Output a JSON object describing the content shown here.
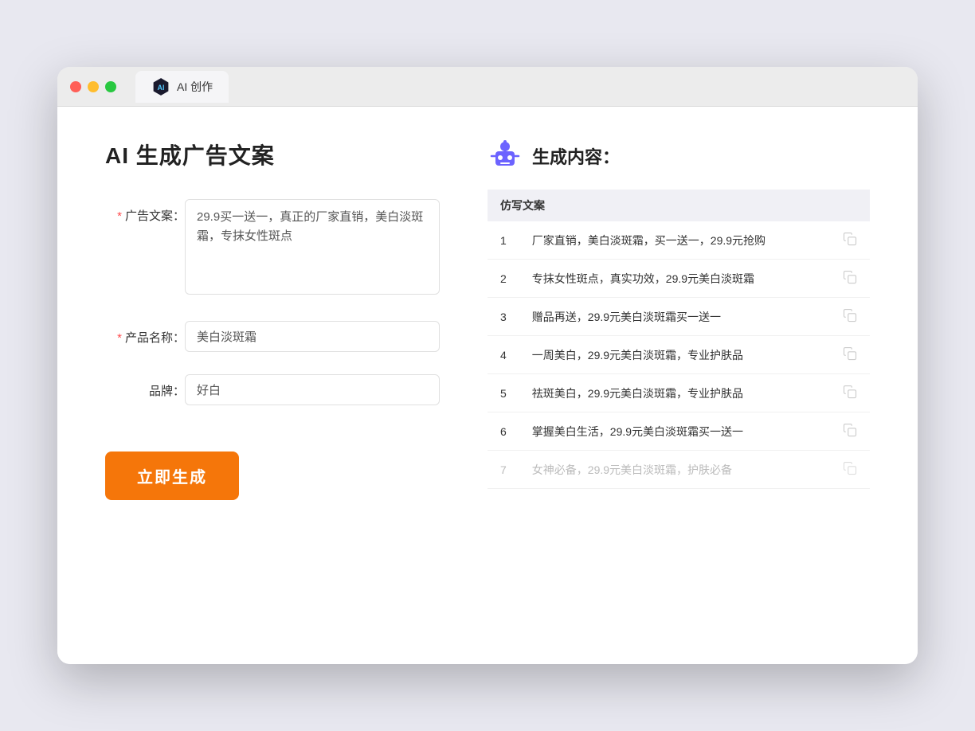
{
  "browser": {
    "tab_label": "AI 创作"
  },
  "page": {
    "title": "AI 生成广告文案",
    "result_title": "生成内容："
  },
  "form": {
    "ad_copy_label": "广告文案：",
    "ad_copy_required": true,
    "ad_copy_value": "29.9买一送一，真正的厂家直销，美白淡斑霜，专抹女性斑点",
    "product_name_label": "产品名称：",
    "product_name_required": true,
    "product_name_value": "美白淡斑霜",
    "brand_label": "品牌：",
    "brand_required": false,
    "brand_value": "好白",
    "generate_button": "立即生成"
  },
  "results": {
    "column_header": "仿写文案",
    "items": [
      {
        "num": 1,
        "text": "厂家直销，美白淡斑霜，买一送一，29.9元抢购"
      },
      {
        "num": 2,
        "text": "专抹女性斑点，真实功效，29.9元美白淡斑霜"
      },
      {
        "num": 3,
        "text": "赠品再送，29.9元美白淡斑霜买一送一"
      },
      {
        "num": 4,
        "text": "一周美白，29.9元美白淡斑霜，专业护肤品"
      },
      {
        "num": 5,
        "text": "祛斑美白，29.9元美白淡斑霜，专业护肤品"
      },
      {
        "num": 6,
        "text": "掌握美白生活，29.9元美白淡斑霜买一送一"
      },
      {
        "num": 7,
        "text": "女神必备，29.9元美白淡斑霜，护肤必备",
        "faded": true
      }
    ]
  }
}
